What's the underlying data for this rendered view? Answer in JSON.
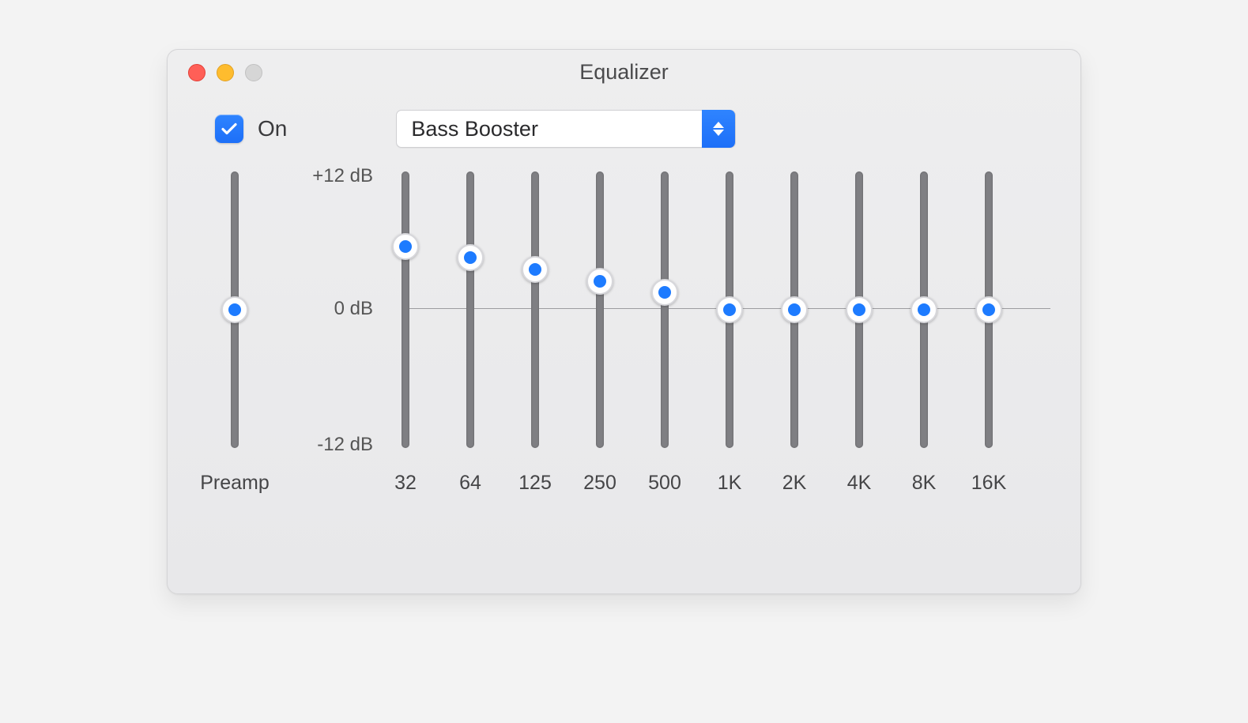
{
  "window": {
    "title": "Equalizer"
  },
  "toggle": {
    "label": "On",
    "checked": true
  },
  "preset": {
    "selected": "Bass Booster"
  },
  "scale": {
    "max": "+12 dB",
    "mid": "0 dB",
    "min": "-12 dB"
  },
  "preamp": {
    "label": "Preamp",
    "value_db": 0
  },
  "bands": [
    {
      "label": "32",
      "value_db": 5.5
    },
    {
      "label": "64",
      "value_db": 4.5
    },
    {
      "label": "125",
      "value_db": 3.5
    },
    {
      "label": "250",
      "value_db": 2.5
    },
    {
      "label": "500",
      "value_db": 1.5
    },
    {
      "label": "1K",
      "value_db": 0
    },
    {
      "label": "2K",
      "value_db": 0
    },
    {
      "label": "4K",
      "value_db": 0
    },
    {
      "label": "8K",
      "value_db": 0
    },
    {
      "label": "16K",
      "value_db": 0
    }
  ],
  "colors": {
    "accent": "#1d7bff"
  }
}
